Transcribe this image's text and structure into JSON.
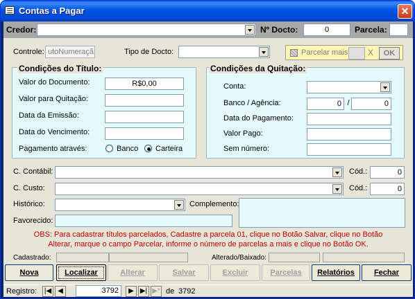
{
  "window": {
    "title": "Contas a Pagar"
  },
  "header": {
    "credor_label": "Credor:",
    "credor_value": "",
    "docto_label": "Nº Docto:",
    "docto_value": "0",
    "parcela_label": "Parcela:",
    "parcela_value": ""
  },
  "row2": {
    "controle_label": "Controle:",
    "controle_value": "utoNumeraçã",
    "tipo_docto_label": "Tipo de Docto:",
    "tipo_docto_value": "",
    "parcelar_label": "Parcelar mais",
    "parcelar_value": "",
    "parcelar_x": "X",
    "ok_label": "OK"
  },
  "titulo": {
    "title": "Condições do Título:",
    "valor_documento_label": "Valor do Documento:",
    "valor_documento_value": "R$0,00",
    "valor_quitacao_label": "Valor para Quitação:",
    "valor_quitacao_value": "",
    "data_emissao_label": "Data da Emissão:",
    "data_emissao_value": "",
    "data_vencimento_label": "Data do Vencimento:",
    "data_vencimento_value": "",
    "pagamento_label": "Pagamento através:",
    "opt_banco": "Banco",
    "opt_carteira": "Carteira",
    "selected": "Carteira"
  },
  "quitacao": {
    "title": "Condições da Quitação:",
    "conta_label": "Conta:",
    "conta_value": "",
    "banco_agencia_label": "Banco / Agência:",
    "banco_value": "0",
    "separator": "/",
    "agencia_value": "0",
    "data_pagamento_label": "Data do Pagamento:",
    "data_pagamento_value": "",
    "valor_pago_label": "Valor Pago:",
    "valor_pago_value": "",
    "sem_numero_label": "Sem número:",
    "sem_numero_value": ""
  },
  "lower": {
    "c_contabil_label": "C. Contábil:",
    "c_contabil_value": "",
    "cod1_label": "Cód.:",
    "cod1_value": "0",
    "c_custo_label": "C. Custo:",
    "c_custo_value": "",
    "cod2_label": "Cód.:",
    "cod2_value": "0",
    "historico_label": "Histórico:",
    "historico_value": "",
    "complemento_label": "Complemento:",
    "complemento_value": "",
    "favorecido_label": "Favorecido:",
    "favorecido_value": ""
  },
  "obs": {
    "line1": "OBS: Para cadastrar títulos parcelados, Cadastre a parcela 01, clique no Botão Salvar, clique no Botão",
    "line2": "Alterar,  marque o campo Parcelar, informe o número de parcelas a mais e clique no Botão OK."
  },
  "audit": {
    "cadastrado_label": "Cadastrado:",
    "alterado_label": "Alterado/Baixado:"
  },
  "buttons": {
    "nova": "Nova",
    "localizar": "Localizar",
    "alterar": "Alterar",
    "salvar": "Salvar",
    "excluir": "Excluir",
    "parcelas": "Parcelas",
    "relatorios": "Relatórios",
    "fechar": "Fechar"
  },
  "navigator": {
    "registro_label": "Registro:",
    "current": "3792",
    "of_label": "de",
    "total": "3792"
  },
  "colors": {
    "panel_bg": "#e4fafa",
    "form_bg": "#e7e4d8",
    "obs_text": "#c00000",
    "titlebar": "#0055e5"
  }
}
